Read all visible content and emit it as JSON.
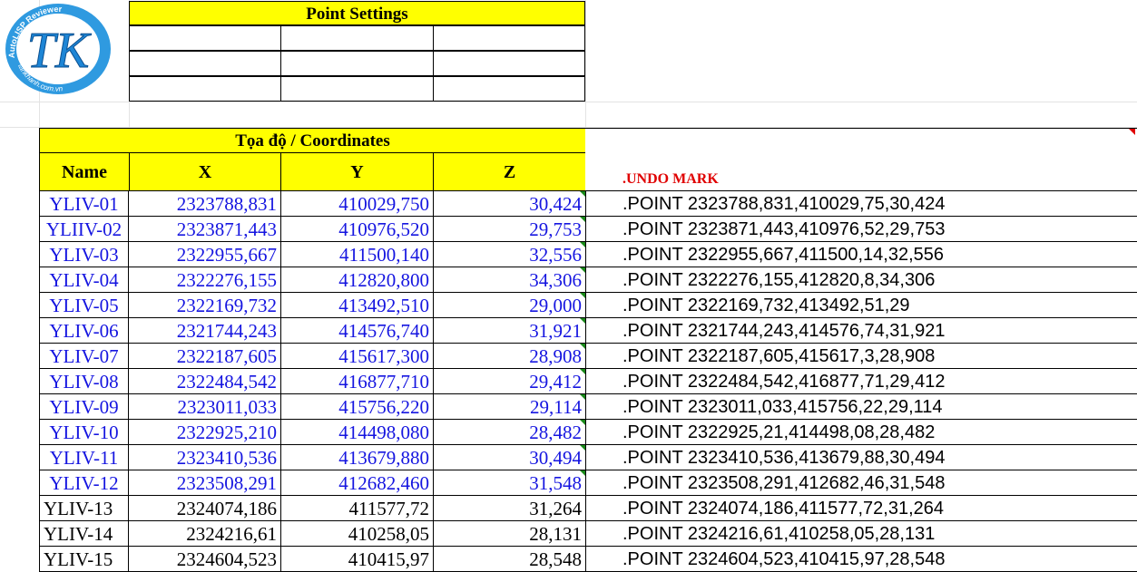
{
  "logo": {
    "letters": "TK",
    "ring_top": "AutoLISP Reviewer",
    "ring_bottom": "tankhanh.com.vn",
    "colors": {
      "primary": "#1e86d6",
      "ring": "#2f9ae0"
    }
  },
  "point_settings": {
    "title": "Point Settings"
  },
  "coordinates": {
    "title": "Tọa độ / Coordinates",
    "headers": {
      "name": "Name",
      "x": "X",
      "y": "Y",
      "z": "Z"
    }
  },
  "command_column": {
    "header": ".UNDO MARK"
  },
  "colors": {
    "header_fill": "#ffff00",
    "blue_text": "#1515e0",
    "undo_red": "#e00000",
    "note_green": "#1a8a1a"
  },
  "rows": [
    {
      "name": "YLIV-01",
      "x": "2323788,831",
      "y": "410029,750",
      "z": "30,424",
      "cmd": ".POINT 2323788,831,410029,75,30,424",
      "style": "blue"
    },
    {
      "name": "YLIIV-02",
      "x": "2323871,443",
      "y": "410976,520",
      "z": "29,753",
      "cmd": ".POINT 2323871,443,410976,52,29,753",
      "style": "blue"
    },
    {
      "name": "YLIV-03",
      "x": "2322955,667",
      "y": "411500,140",
      "z": "32,556",
      "cmd": ".POINT 2322955,667,411500,14,32,556",
      "style": "blue"
    },
    {
      "name": "YLIV-04",
      "x": "2322276,155",
      "y": "412820,800",
      "z": "34,306",
      "cmd": ".POINT 2322276,155,412820,8,34,306",
      "style": "blue"
    },
    {
      "name": "YLIV-05",
      "x": "2322169,732",
      "y": "413492,510",
      "z": "29,000",
      "cmd": ".POINT 2322169,732,413492,51,29",
      "style": "blue"
    },
    {
      "name": "YLIV-06",
      "x": "2321744,243",
      "y": "414576,740",
      "z": "31,921",
      "cmd": ".POINT 2321744,243,414576,74,31,921",
      "style": "blue"
    },
    {
      "name": "YLIV-07",
      "x": "2322187,605",
      "y": "415617,300",
      "z": "28,908",
      "cmd": ".POINT 2322187,605,415617,3,28,908",
      "style": "blue"
    },
    {
      "name": "YLIV-08",
      "x": "2322484,542",
      "y": "416877,710",
      "z": "29,412",
      "cmd": ".POINT 2322484,542,416877,71,29,412",
      "style": "blue"
    },
    {
      "name": "YLIV-09",
      "x": "2323011,033",
      "y": "415756,220",
      "z": "29,114",
      "cmd": ".POINT 2323011,033,415756,22,29,114",
      "style": "blue"
    },
    {
      "name": "YLIV-10",
      "x": "2322925,210",
      "y": "414498,080",
      "z": "28,482",
      "cmd": ".POINT 2322925,21,414498,08,28,482",
      "style": "blue"
    },
    {
      "name": "YLIV-11",
      "x": "2323410,536",
      "y": "413679,880",
      "z": "30,494",
      "cmd": ".POINT 2323410,536,413679,88,30,494",
      "style": "blue"
    },
    {
      "name": "YLIV-12",
      "x": "2323508,291",
      "y": "412682,460",
      "z": "31,548",
      "cmd": ".POINT 2323508,291,412682,46,31,548",
      "style": "blue"
    },
    {
      "name": "YLIV-13",
      "x": "2324074,186",
      "y": "411577,72",
      "z": "31,264",
      "cmd": ".POINT 2324074,186,411577,72,31,264",
      "style": "black"
    },
    {
      "name": "YLIV-14",
      "x": "2324216,61",
      "y": "410258,05",
      "z": "28,131",
      "cmd": ".POINT 2324216,61,410258,05,28,131",
      "style": "black"
    },
    {
      "name": "YLIV-15",
      "x": "2324604,523",
      "y": "410415,97",
      "z": "28,548",
      "cmd": ".POINT 2324604,523,410415,97,28,548",
      "style": "black"
    }
  ]
}
